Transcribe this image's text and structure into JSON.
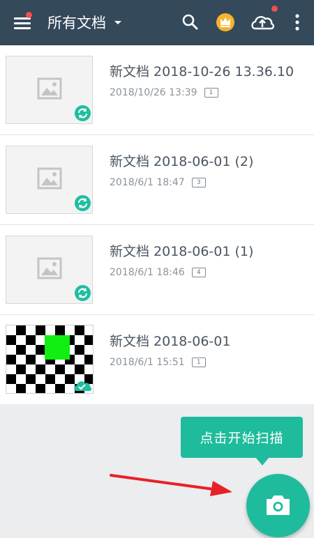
{
  "header": {
    "title": "所有文档"
  },
  "documents": [
    {
      "name": "新文档 2018-10-26 13.36.10",
      "date": "2018/10/26 13:39",
      "pages": "1",
      "status": "syncing"
    },
    {
      "name": "新文档 2018-06-01 (2)",
      "date": "2018/6/1 18:47",
      "pages": "3",
      "status": "syncing"
    },
    {
      "name": "新文档 2018-06-01 (1)",
      "date": "2018/6/1 18:46",
      "pages": "4",
      "status": "syncing"
    },
    {
      "name": "新文档 2018-06-01",
      "date": "2018/6/1 15:51",
      "pages": "1",
      "status": "synced"
    }
  ],
  "tooltip": {
    "text": "点击开始扫描"
  },
  "icons": [
    "menu-icon",
    "search-icon",
    "crown-icon",
    "cloud-upload-icon",
    "more-vert-icon",
    "image-placeholder-icon",
    "sync-icon",
    "cloud-check-icon",
    "camera-icon"
  ],
  "colors": {
    "appbar": "#34495a",
    "accent": "#1fbb9d",
    "notification": "#f05050",
    "arrow": "#e8202a"
  }
}
